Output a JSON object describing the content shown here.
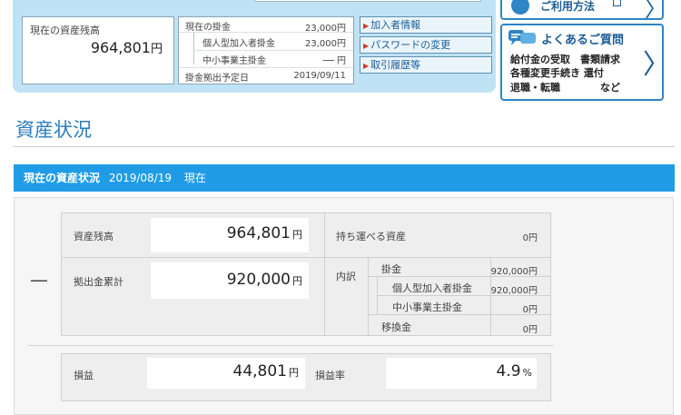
{
  "summary": {
    "balance_label": "現在の資産残高",
    "balance_value": "964,801",
    "yen": "円",
    "current_contrib_label": "現在の掛金",
    "current_contrib_value": "23,000円",
    "individual_label": "個人型加入者掛金",
    "individual_value": "23,000円",
    "sme_label": "中小事業主掛金",
    "sme_value": "── 円",
    "scheduled_label": "掛金拠出予定日",
    "scheduled_value": "2019/09/11"
  },
  "links": [
    "加入者情報",
    "パスワードの変更",
    "取引履歴等"
  ],
  "side": {
    "usage_label": "ご利用方法",
    "faq_title": "よくあるご質問",
    "faq_lines": [
      "給付金の受取　書類請求",
      "各種変更手続き 還付",
      "退職・転職　　　　など"
    ]
  },
  "section_title": "資産状況",
  "bar": {
    "title": "現在の資産状況",
    "date": "2019/08/19",
    "suffix": "現在"
  },
  "assets": {
    "balance_label": "資産残高",
    "balance_value": "964,801",
    "portable_label": "持ち運べる資産",
    "portable_value": "0円",
    "contrib_total_label": "拠出金累計",
    "contrib_total_value": "920,000",
    "breakdown_label": "内訳",
    "kakekin_label": "掛金",
    "kakekin_value": "920,000円",
    "indiv_label": "個人型加入者掛金",
    "indiv_value": "920,000円",
    "sme_label": "中小事業主掛金",
    "sme_value": "0円",
    "transfer_label": "移換金",
    "transfer_value": "0円",
    "collapse_symbol": "—",
    "profit_label": "損益",
    "profit_value": "44,801",
    "rate_label": "損益率",
    "rate_value": "4.9",
    "percent": "%",
    "yen": "円"
  }
}
